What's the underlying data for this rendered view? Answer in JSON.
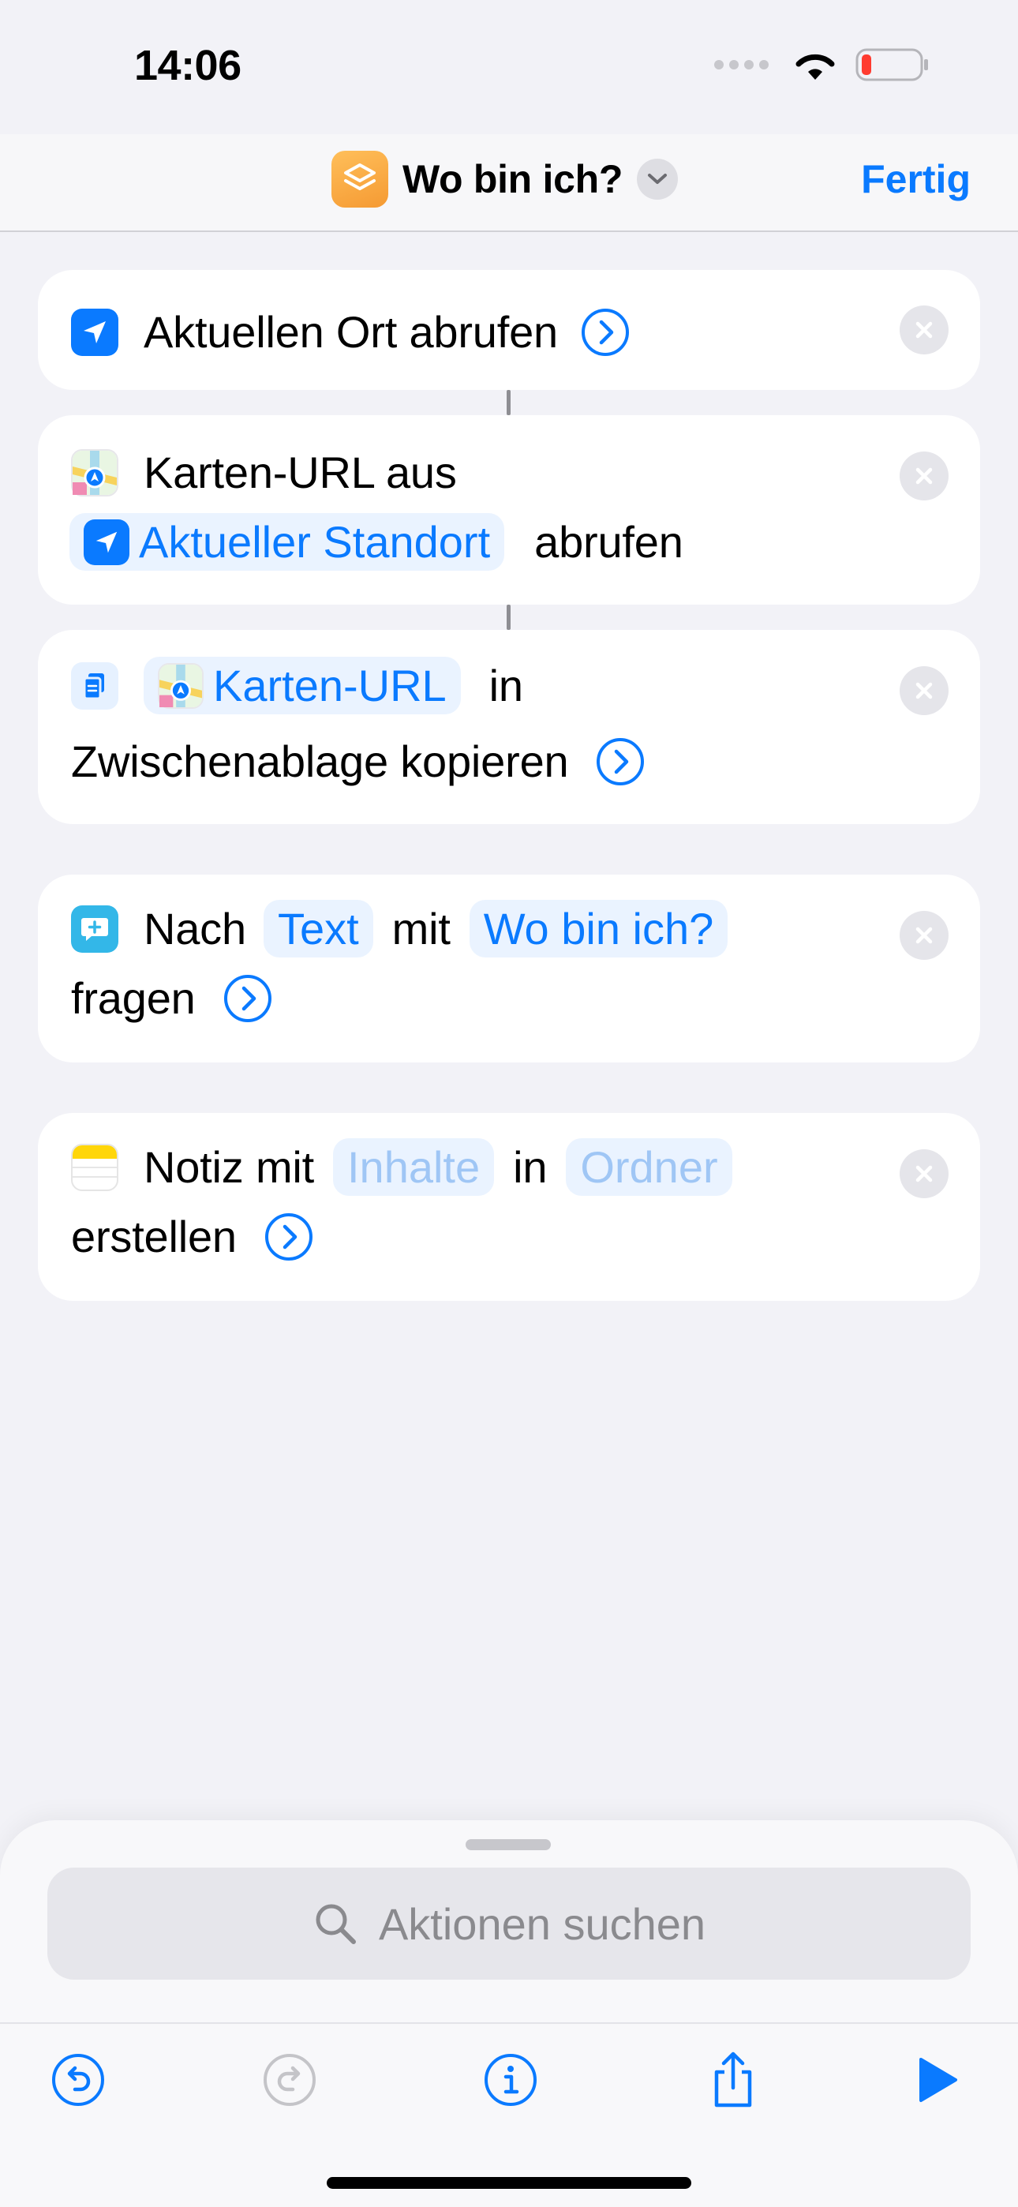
{
  "status_bar": {
    "time": "14:06"
  },
  "nav": {
    "title": "Wo bin ich?",
    "done_label": "Fertig"
  },
  "actions": [
    {
      "line1": "Aktuellen Ort abrufen"
    },
    {
      "line1": "Karten-URL aus",
      "chip": "Aktueller Standort",
      "line2_suffix": "abrufen"
    },
    {
      "chip": "Karten-URL",
      "line1_suffix": "in",
      "line2": "Zwischenablage kopieren"
    },
    {
      "prefix": "Nach",
      "chip1": "Text",
      "middle": "mit",
      "chip2": "Wo bin ich?",
      "line2": "fragen"
    },
    {
      "prefix": "Notiz mit",
      "chip1": "Inhalte",
      "middle": "in",
      "chip2": "Ordner",
      "line2": "erstellen"
    }
  ],
  "search": {
    "placeholder": "Aktionen suchen"
  },
  "icons": {
    "location": "location-arrow-icon",
    "maps": "maps-icon",
    "clipboard": "clipboard-icon",
    "ask": "speech-bubble-icon",
    "notes": "notes-icon",
    "undo": "undo-icon",
    "redo": "redo-icon",
    "info": "info-icon",
    "share": "share-icon",
    "play": "play-icon"
  },
  "colors": {
    "accent": "#0a7aff",
    "shortcut_icon": "#f59a33",
    "battery_low": "#ff3b30"
  }
}
